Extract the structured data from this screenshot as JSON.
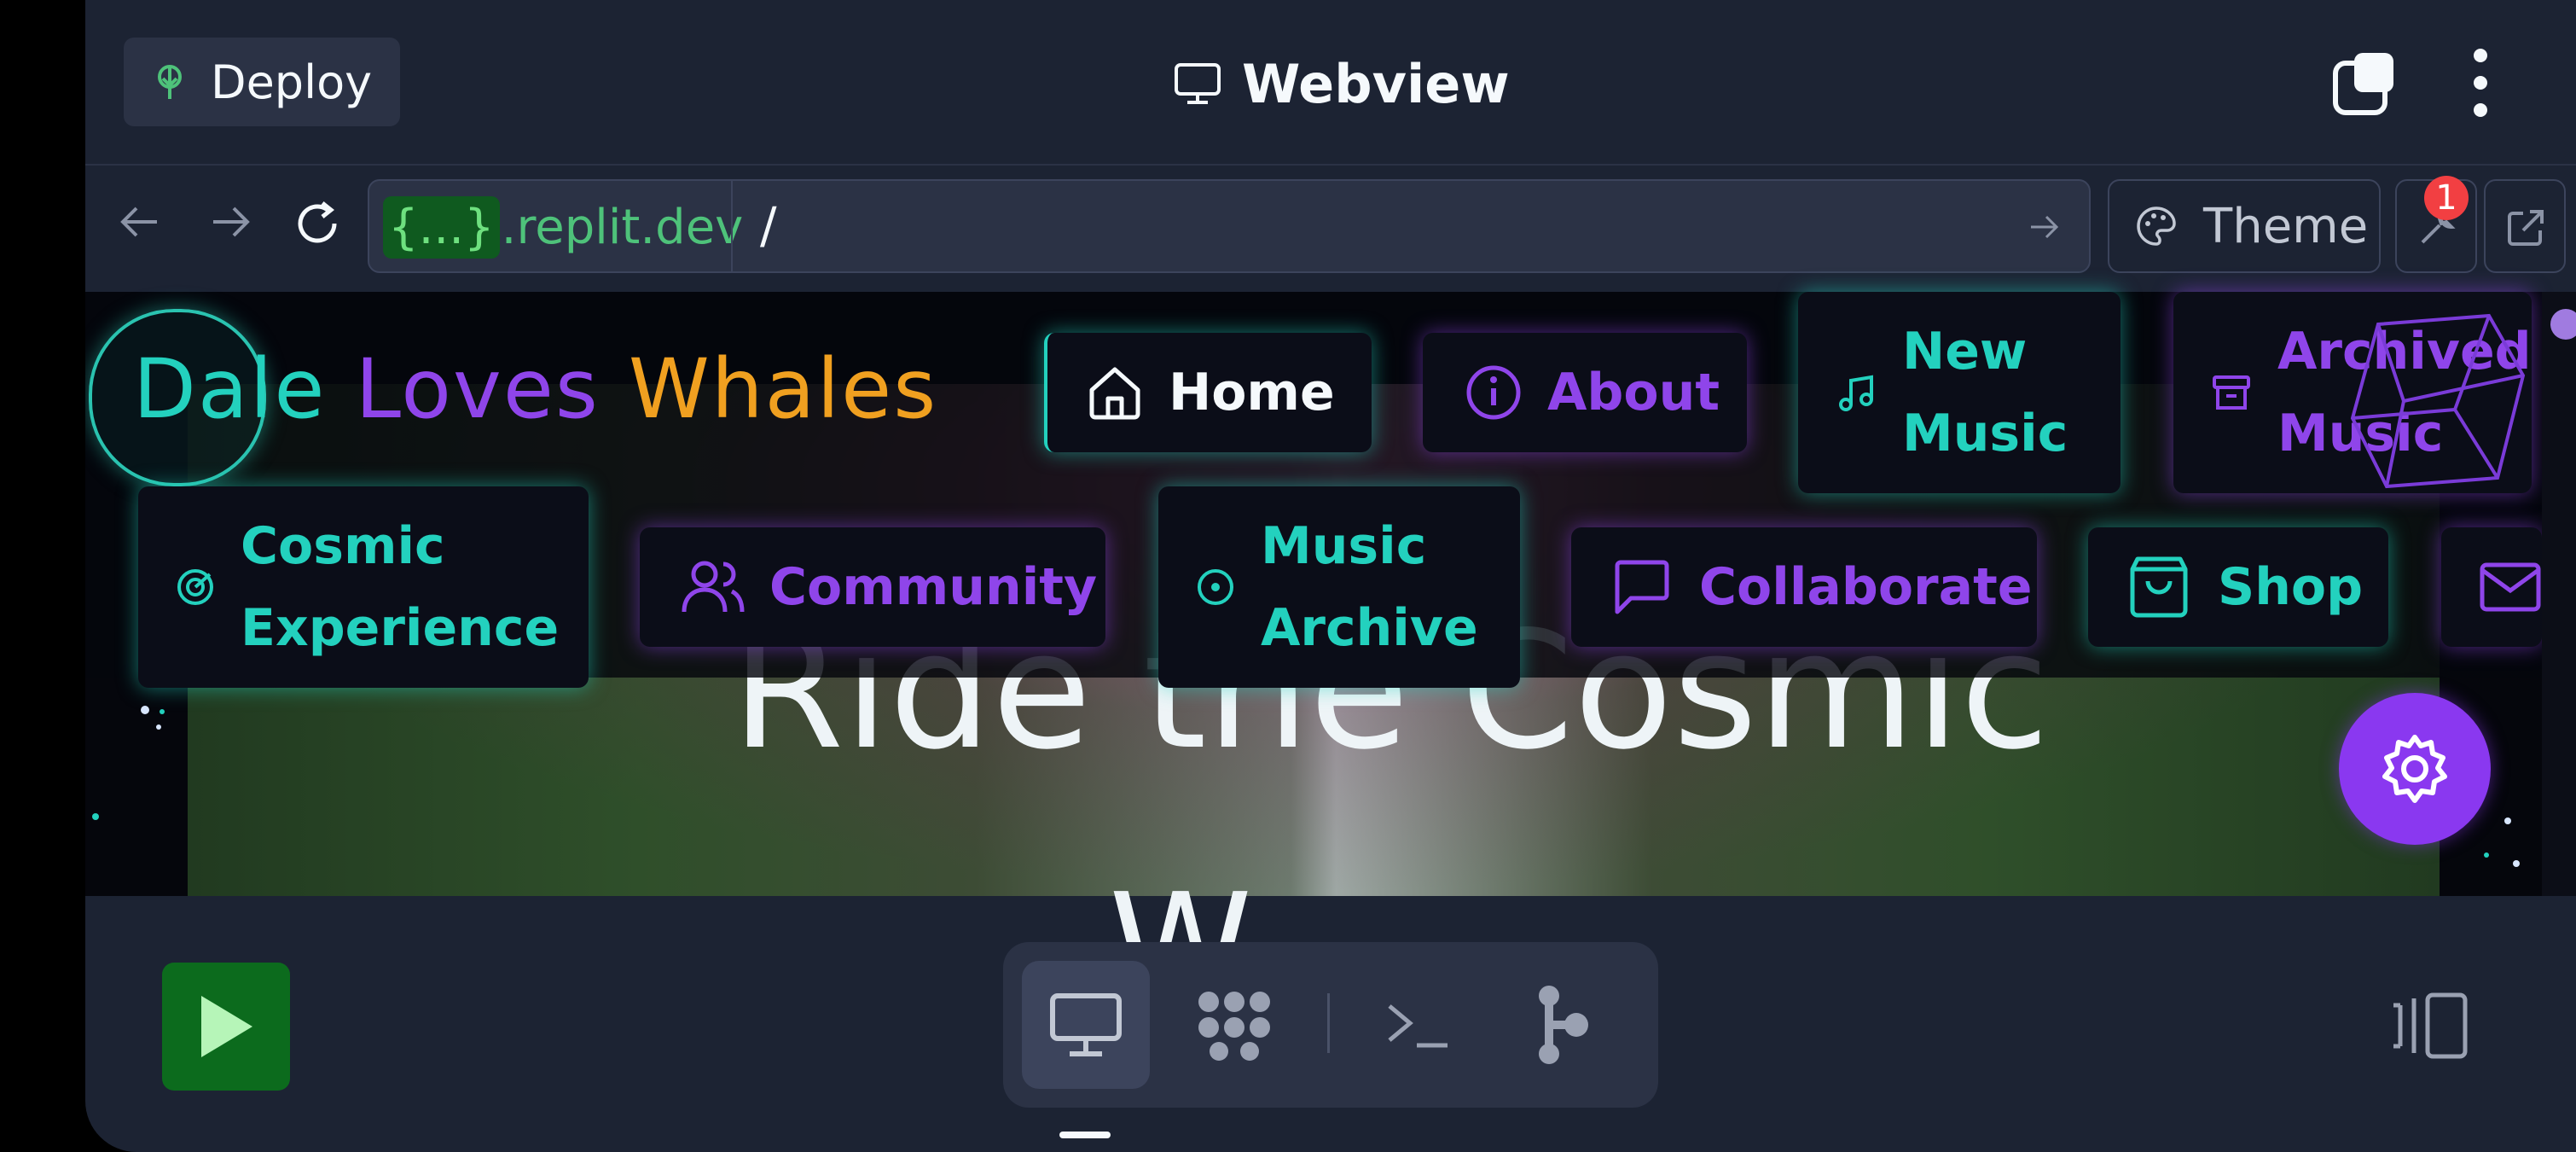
{
  "topbar": {
    "deploy_label": "Deploy",
    "title": "Webview"
  },
  "urlbar": {
    "host_braces": "{...}",
    "host_domain": ".replit.dev",
    "path": "/",
    "theme_label": "Theme",
    "devtools_badge": "1"
  },
  "site": {
    "brand": {
      "word1": "Dale",
      "word2": "Loves",
      "word3": "Whales",
      "color1": "#23d1be",
      "color2": "#8f45ea",
      "color3": "#f0a020"
    },
    "nav_row1": [
      {
        "label": "Home",
        "icon": "home-icon"
      },
      {
        "label": "About",
        "icon": "info-icon"
      },
      {
        "label_line1": "New",
        "label_line2": "Music",
        "icon": "music-note-icon"
      },
      {
        "label_line1": "Archived",
        "label_line2": "Music",
        "icon": "archive-icon"
      }
    ],
    "nav_row2": [
      {
        "label_line1": "Cosmic",
        "label_line2": "Experience",
        "icon": "radar-icon"
      },
      {
        "label": "Community",
        "icon": "users-icon"
      },
      {
        "label_line1": "Music",
        "label_line2": "Archive",
        "icon": "disc-icon"
      },
      {
        "label": "Collaborate",
        "icon": "chat-icon"
      },
      {
        "label": "Shop",
        "icon": "shopping-bag-icon"
      },
      {
        "label": "",
        "icon": "mail-icon"
      }
    ],
    "hero_line1": "Ride the Cosmic",
    "hero_line2": "W"
  },
  "colors": {
    "accent_teal": "#23d1be",
    "accent_purple": "#8f45ea",
    "accent_orange": "#f0a020",
    "run_green": "#0c6b1d"
  }
}
